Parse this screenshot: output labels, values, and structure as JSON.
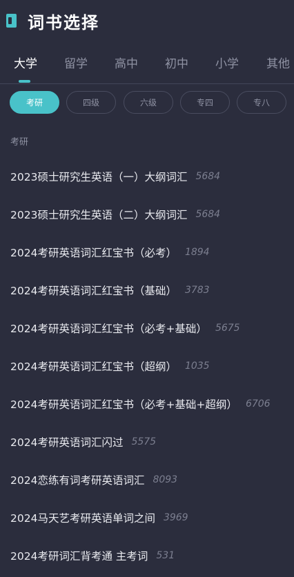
{
  "header": {
    "title": "词书选择",
    "icon": "book-icon"
  },
  "tabs": [
    {
      "label": "大学",
      "active": true
    },
    {
      "label": "留学",
      "active": false
    },
    {
      "label": "高中",
      "active": false
    },
    {
      "label": "初中",
      "active": false
    },
    {
      "label": "小学",
      "active": false
    },
    {
      "label": "其他",
      "active": false
    }
  ],
  "chips": [
    {
      "label": "考研",
      "active": true
    },
    {
      "label": "四级",
      "active": false
    },
    {
      "label": "六级",
      "active": false
    },
    {
      "label": "专四",
      "active": false
    },
    {
      "label": "专八",
      "active": false
    }
  ],
  "section": {
    "label": "考研"
  },
  "books": [
    {
      "name": "2023硕士研究生英语（一）大纲词汇",
      "count": "5684"
    },
    {
      "name": "2023硕士研究生英语（二）大纲词汇",
      "count": "5684"
    },
    {
      "name": "2024考研英语词汇红宝书（必考）",
      "count": "1894"
    },
    {
      "name": "2024考研英语词汇红宝书（基础）",
      "count": "3783"
    },
    {
      "name": "2024考研英语词汇红宝书（必考+基础）",
      "count": "5675"
    },
    {
      "name": "2024考研英语词汇红宝书（超纲）",
      "count": "1035"
    },
    {
      "name": "2024考研英语词汇红宝书（必考+基础+超纲）",
      "count": "6706"
    },
    {
      "name": "2024考研英语词汇闪过",
      "count": "5575"
    },
    {
      "name": "2024恋练有词考研英语词汇",
      "count": "8093"
    },
    {
      "name": "2024马天艺考研英语单词之间",
      "count": "3969"
    },
    {
      "name": "2024考研词汇背考通 主考词",
      "count": "531"
    }
  ],
  "colors": {
    "background": "#2b2d3d",
    "accent": "#49c2c9",
    "muted": "#8f92a3"
  }
}
